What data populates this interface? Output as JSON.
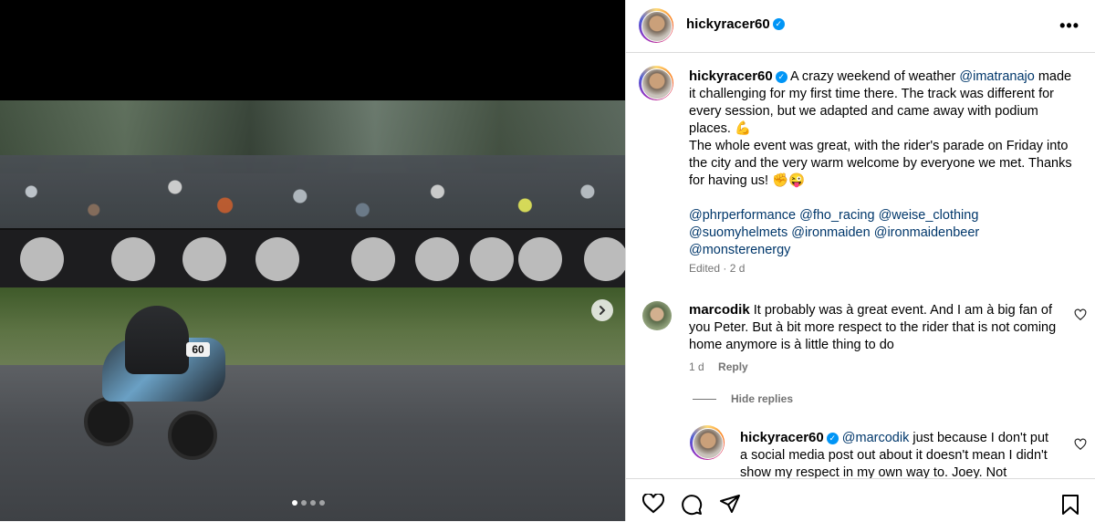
{
  "post": {
    "username": "hickyracer60",
    "more_icon": "more-horizontal-icon"
  },
  "media": {
    "bike_number": "60",
    "dots_count": 4,
    "active_dot": 0
  },
  "caption": {
    "username": "hickyracer60",
    "mention_intro": "@imatranajo",
    "text_1": "A crazy weekend of weather",
    "text_2": "made it challenging for my first time there. The track was different for every session, but we adapted and came away with podium places. 💪",
    "text_3": "The whole event was great, with the rider's parade on Friday into the city and the very warm welcome by everyone we met. Thanks for having us! ✊😜",
    "tags": [
      "@phrperformance",
      "@fho_racing",
      "@weise_clothing",
      "@suomyhelmets",
      "@ironmaiden",
      "@ironmaidenbeer",
      "@monsterenergy"
    ],
    "edited": "Edited · 2 d"
  },
  "comments": [
    {
      "username": "marcodik",
      "text": "It probably was à great event. And I am à big fan of you Peter. But à bit more respect to the rider that is not coming home anymore is à little thing to do",
      "age": "1 d",
      "reply_label": "Reply"
    }
  ],
  "hide_replies": "Hide replies",
  "reply": {
    "username": "hickyracer60",
    "mention": "@marcodik",
    "text": "just because I don't put a social media post out about it doesn't mean I didn't show my respect in my own way to. Joey. Not"
  }
}
